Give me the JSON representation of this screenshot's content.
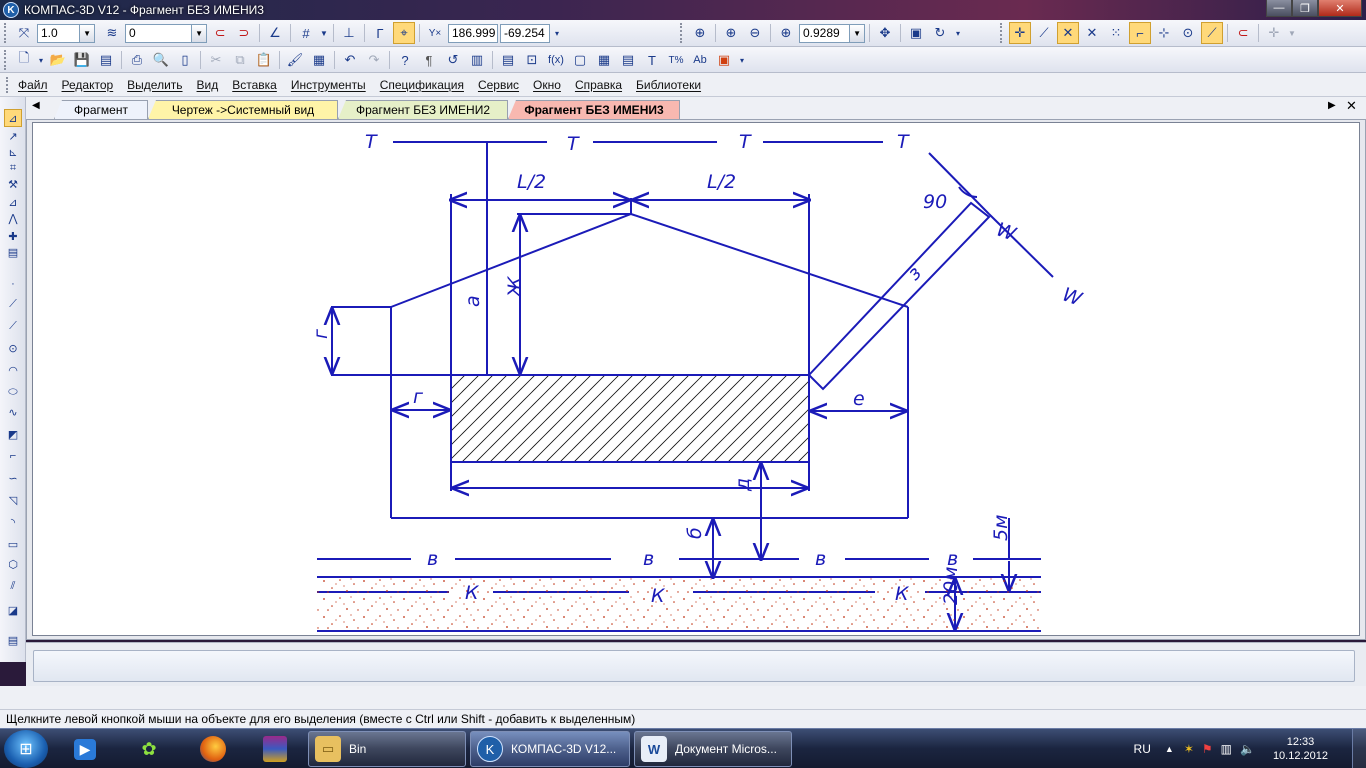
{
  "window": {
    "title": "КОМПАС-3D V12 - Фрагмент БЕЗ ИМЕНИ3",
    "btn_minimize": "—",
    "btn_maximize": "❐",
    "btn_close": "✕"
  },
  "toolbar1": {
    "scale_value": "1.0",
    "layer_value": "0",
    "coord_x": "186.999",
    "coord_y": "-69.254",
    "zoom_value": "0.9289"
  },
  "menu": {
    "items": [
      "Файл",
      "Редактор",
      "Выделить",
      "Вид",
      "Вставка",
      "Инструменты",
      "Спецификация",
      "Сервис",
      "Окно",
      "Справка",
      "Библиотеки"
    ]
  },
  "tabs": [
    {
      "label": "Фрагмент",
      "color": "#eef2fb"
    },
    {
      "label": "Чертеж ->Системный вид",
      "color": "#fff4a8"
    },
    {
      "label": "Фрагмент БЕЗ ИМЕНИ2",
      "color": "#e6f0c8"
    },
    {
      "label": "Фрагмент БЕЗ ИМЕНИ3",
      "color": "#f8b8b0"
    }
  ],
  "drawing": {
    "labels": {
      "t": "Т",
      "half_length": "L/2",
      "angle": "90",
      "w": "W",
      "a": "а",
      "zh": "Ж",
      "g": "г",
      "z": "з",
      "e": "е",
      "d": "д",
      "b": "б",
      "v": "в",
      "k": "К",
      "five_m": "5м",
      "twenty_m": "20м"
    },
    "line_color": "#1b1bb8",
    "soil_dot_color": "#c03010"
  },
  "status": {
    "hint": "Щелкните левой кнопкой мыши на объекте для его выделения (вместе с Ctrl или Shift - добавить к выделенным)"
  },
  "taskbar": {
    "start_icon": "start-orb",
    "tasks": [
      {
        "label": "Bin",
        "icon": "folder-icon"
      },
      {
        "label": "КОМПАС-3D V12...",
        "icon": "kompas-icon"
      },
      {
        "label": "Документ Micros...",
        "icon": "word-icon"
      }
    ],
    "lang": "RU",
    "time": "12:33",
    "date": "10.12.2012"
  }
}
